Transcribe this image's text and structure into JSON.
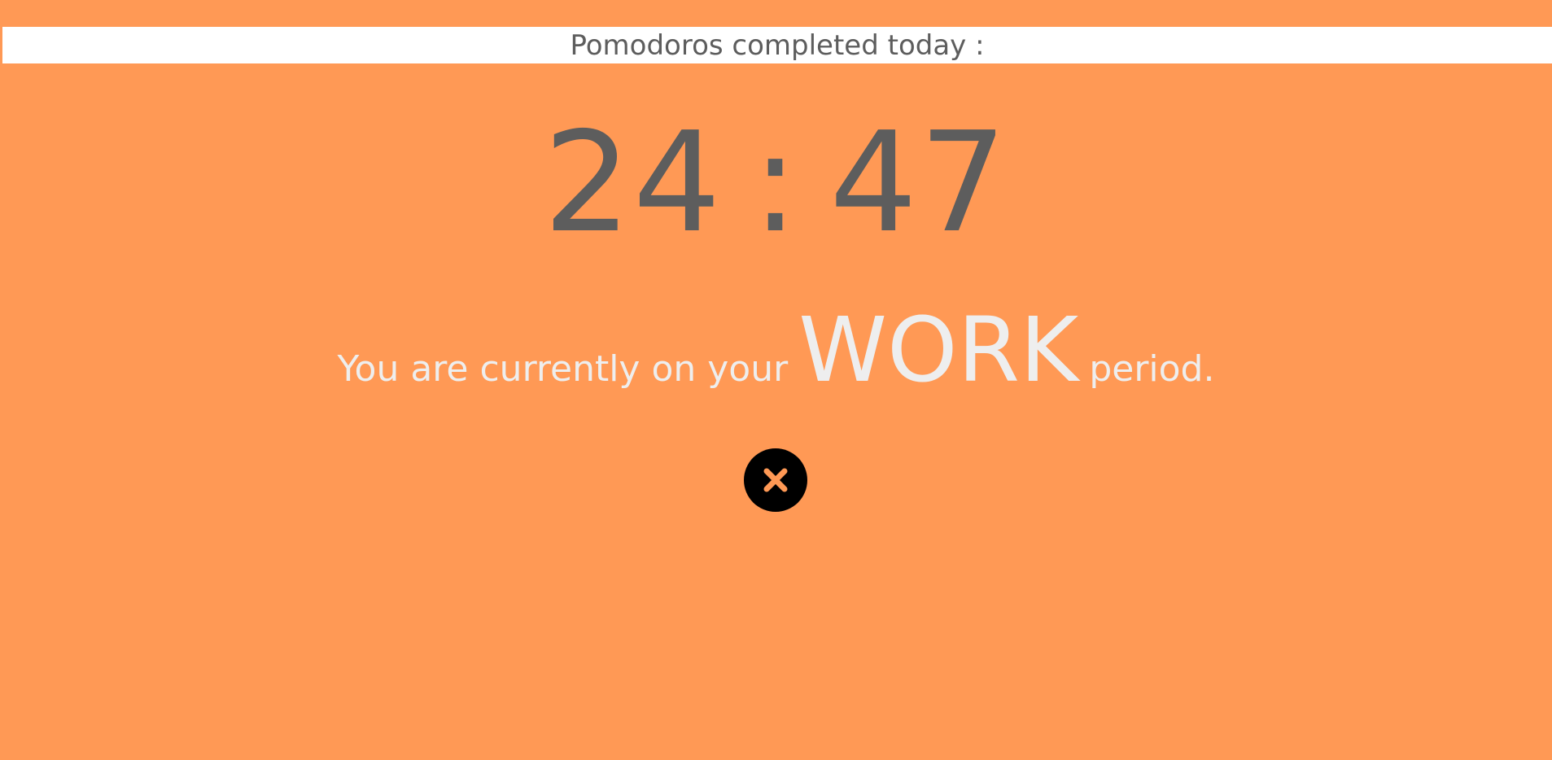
{
  "header": {
    "pomodoros_label": "Pomodoros completed today :"
  },
  "timer": {
    "minutes": "24",
    "separator": ":",
    "seconds": "47"
  },
  "status": {
    "prefix": "You are currently on your",
    "period": "WORK",
    "suffix": "period."
  },
  "controls": {
    "stop_icon": "close-icon"
  },
  "colors": {
    "background": "#FF9955",
    "header_bg": "#FFFFFF",
    "dark_text": "#5D5D5D",
    "light_text": "#EEEEEE",
    "button_bg": "#000000",
    "button_icon": "#FF9955"
  }
}
